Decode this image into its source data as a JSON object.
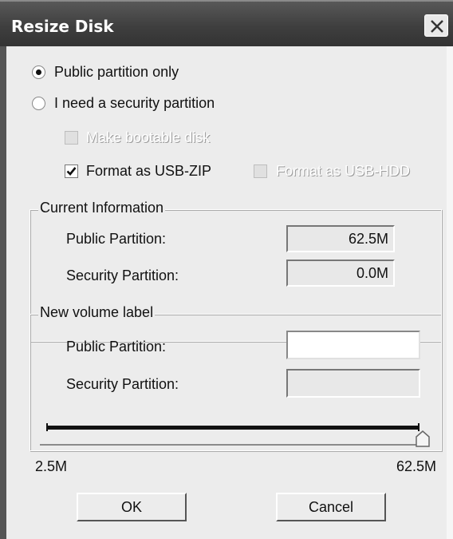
{
  "window": {
    "title": "Resize Disk"
  },
  "options": {
    "public_only": {
      "label": "Public partition only",
      "selected": true
    },
    "security": {
      "label": "I need a security partition",
      "selected": false
    },
    "bootable": {
      "label": "Make bootable disk",
      "checked": false,
      "enabled": false
    },
    "usb_zip": {
      "label": "Format as USB-ZIP",
      "checked": true,
      "enabled": true
    },
    "usb_hdd": {
      "label": "Format as USB-HDD",
      "checked": false,
      "enabled": false
    }
  },
  "current_info": {
    "title": "Current Information",
    "public_label": "Public Partition:",
    "public_value": "62.5M",
    "security_label": "Security Partition:",
    "security_value": "0.0M"
  },
  "new_volume": {
    "title": "New volume label",
    "public_label": "Public Partition:",
    "public_value": "",
    "security_label": "Security Partition:",
    "security_value": ""
  },
  "slider": {
    "min_label": "2.5M",
    "max_label": "62.5M",
    "value": "62.5M",
    "fraction": 1.0
  },
  "buttons": {
    "ok": "OK",
    "cancel": "Cancel"
  },
  "colors": {
    "titlebar": "#444444",
    "dialog_bg": "#ececec"
  }
}
